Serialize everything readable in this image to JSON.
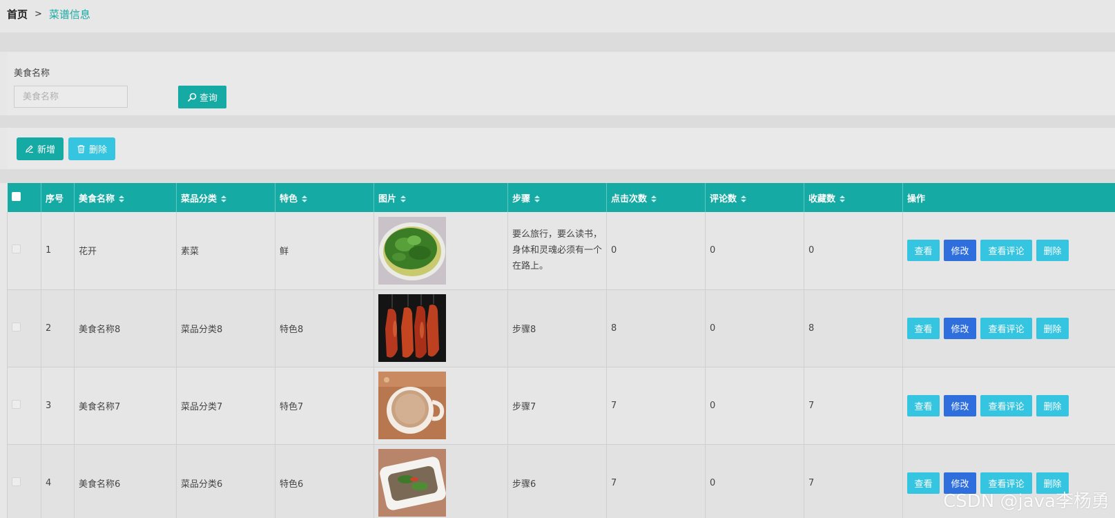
{
  "breadcrumb": {
    "home": "首页",
    "separator": ">",
    "current": "菜谱信息"
  },
  "search": {
    "label": "美食名称",
    "placeholder": "美食名称",
    "value": "",
    "button_label": "查询"
  },
  "toolbar": {
    "add_label": "新增",
    "delete_label": "删除"
  },
  "table": {
    "headers": {
      "index": "序号",
      "name": "美食名称",
      "category": "菜品分类",
      "feature": "特色",
      "image": "图片",
      "steps": "步骤",
      "clicks": "点击次数",
      "comments": "评论数",
      "favorites": "收藏数",
      "actions": "操作"
    },
    "action_labels": {
      "view": "查看",
      "edit": "修改",
      "view_comments": "查看评论",
      "delete": "删除"
    },
    "rows": [
      {
        "index": "1",
        "name": "花开",
        "category": "素菜",
        "feature": "鲜",
        "image": "greens-dish",
        "steps": "要么旅行，要么读书，身体和灵魂必须有一个在路上。",
        "clicks": "0",
        "comments": "0",
        "favorites": "0"
      },
      {
        "index": "2",
        "name": "美食名称8",
        "category": "菜品分类8",
        "feature": "特色8",
        "image": "roast-duck",
        "steps": "步骤8",
        "clicks": "8",
        "comments": "0",
        "favorites": "8"
      },
      {
        "index": "3",
        "name": "美食名称7",
        "category": "菜品分类7",
        "feature": "特色7",
        "image": "milk-tea",
        "steps": "步骤7",
        "clicks": "7",
        "comments": "0",
        "favorites": "7"
      },
      {
        "index": "4",
        "name": "美食名称6",
        "category": "菜品分类6",
        "feature": "特色6",
        "image": "cold-dish",
        "steps": "步骤6",
        "clicks": "7",
        "comments": "0",
        "favorites": "7"
      }
    ]
  },
  "watermark": "CSDN @java李杨勇",
  "colors": {
    "primary": "#16aaa4",
    "info": "#35c5e0",
    "edit": "#2f6fdd"
  }
}
